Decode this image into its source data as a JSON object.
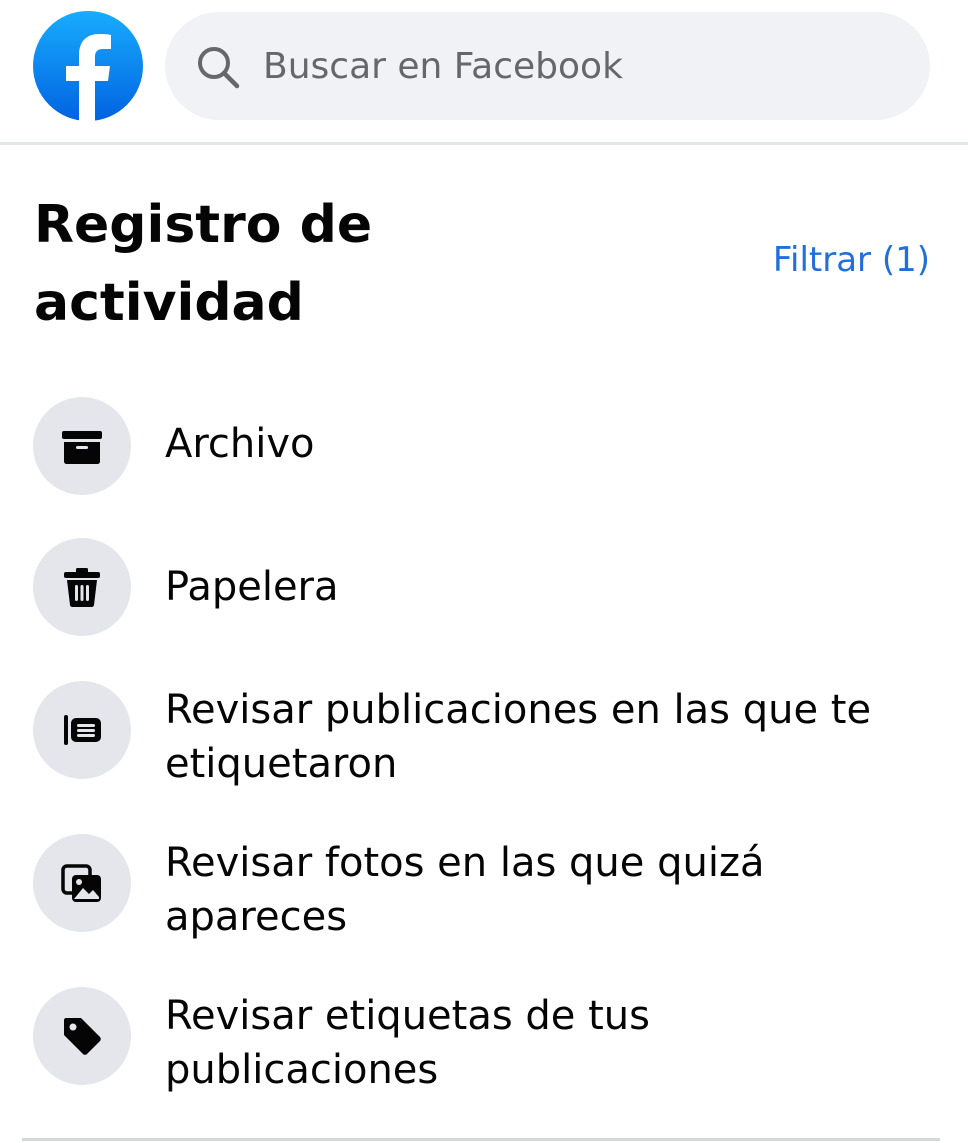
{
  "header": {
    "logo_icon": "facebook-logo",
    "search_placeholder": "Buscar en Facebook",
    "search_icon": "search-icon"
  },
  "page": {
    "title": "Registro de actividad",
    "filter_label": "Filtrar (1)",
    "accent_color": "#216fdb"
  },
  "menu": {
    "items": [
      {
        "label": "Archivo",
        "icon": "archive-icon"
      },
      {
        "label": "Papelera",
        "icon": "trash-icon"
      },
      {
        "label": "Revisar publicaciones en las que te etiquetaron",
        "icon": "tagged-posts-icon"
      },
      {
        "label": "Revisar fotos en las que quizá apareces",
        "icon": "photos-icon"
      },
      {
        "label": "Revisar etiquetas de tus publicaciones",
        "icon": "tag-icon"
      }
    ]
  }
}
